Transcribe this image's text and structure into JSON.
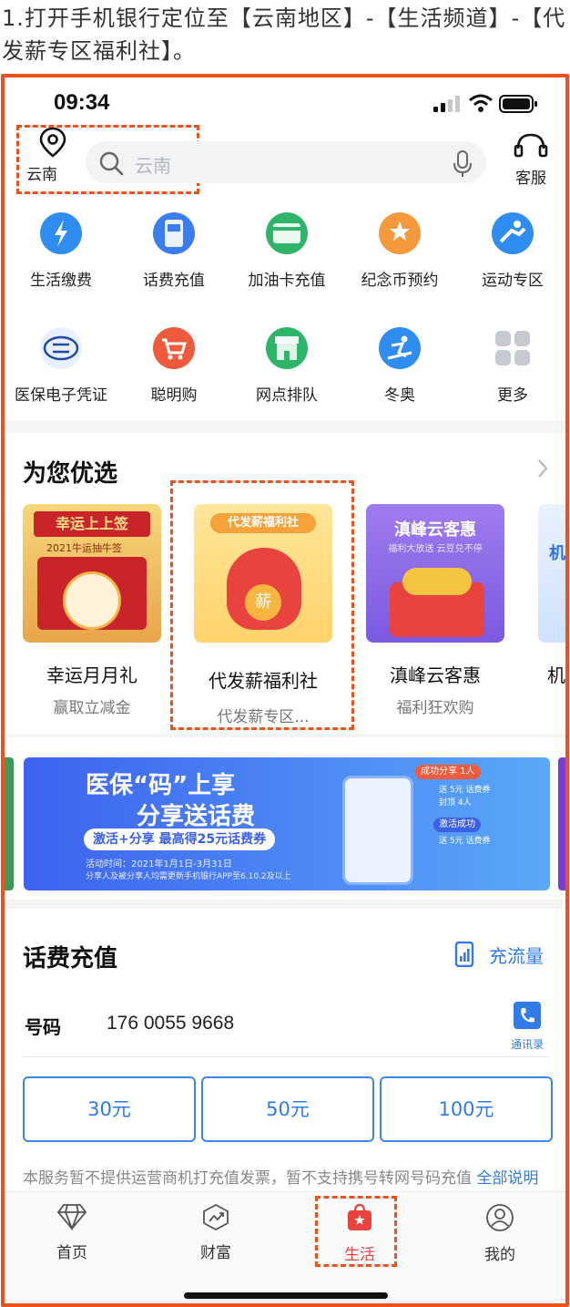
{
  "caption": "1.打开手机银行定位至【云南地区】-【生活频道】-【代发薪专区福利社】。",
  "status": {
    "time": "09:34"
  },
  "header": {
    "location_label": "云南",
    "search_placeholder": "云南",
    "service_label": "客服"
  },
  "services": [
    {
      "label": "生活缴费",
      "icon": "lightning-icon",
      "color": "#2f8cf0"
    },
    {
      "label": "话费充值",
      "icon": "phone-bill-icon",
      "color": "#3b7df0"
    },
    {
      "label": "加油卡充值",
      "icon": "fuel-card-icon",
      "color": "#2fb56a"
    },
    {
      "label": "纪念币预约",
      "icon": "coin-star-icon",
      "color": "#f59a3c"
    },
    {
      "label": "运动专区",
      "icon": "sport-icon",
      "color": "#2f8cf0"
    },
    {
      "label": "医保电子凭证",
      "icon": "chs-icon",
      "color": "#1f4aa8"
    },
    {
      "label": "聪明购",
      "icon": "cart-icon",
      "color": "#f05a3c"
    },
    {
      "label": "网点排队",
      "icon": "store-icon",
      "color": "#2fb56a"
    },
    {
      "label": "冬奥",
      "icon": "ski-icon",
      "color": "#2f8cf0"
    },
    {
      "label": "更多",
      "icon": "more-grid-icon",
      "color": "#c6c9cf"
    }
  ],
  "picks": {
    "title": "为您优选",
    "cards": [
      {
        "title": "幸运月月礼",
        "subtitle": "赢取立减金",
        "img_text": "幸运上上签",
        "img_sub": "2021牛运抽牛签"
      },
      {
        "title": "代发薪福利社",
        "subtitle": "代发薪专区...",
        "img_text": "代发薪福利社",
        "badge": "薪"
      },
      {
        "title": "滇峰云客惠",
        "subtitle": "福利狂欢购",
        "img_text": "滇峰云客惠",
        "img_sub": "福利大放送 云豆兑不停"
      },
      {
        "title": "机",
        "subtitle": "",
        "img_text": "机"
      }
    ]
  },
  "banner": {
    "line1": "医保“码”上享",
    "line2": "分享送话费",
    "line3": "激活+分享 最高得25元话费券",
    "line4": "活动时间：2021年1月1日-3月31日",
    "line5": "分享人及被分享人均需更新手机银行APP至6.10.2及以上",
    "tag1": "成功分享 1人",
    "tag1_sub": "送 5元 话费券",
    "tag1_sub2": "封顶 4人",
    "tag2": "激活成功",
    "tag2_sub": "送 5元 话费券"
  },
  "recharge": {
    "title": "话费充值",
    "flow_label": "充流量",
    "number_label": "号码",
    "number": "176 0055 9668",
    "contacts_label": "通讯录",
    "amounts": [
      "30元",
      "50元",
      "100元"
    ],
    "note": "本服务暂不提供运营商机打充值发票，暂不支持携号转网号码充值",
    "note_more": "全部说明"
  },
  "tabs": [
    {
      "label": "首页",
      "icon": "diamond-icon"
    },
    {
      "label": "财富",
      "icon": "wealth-chart-icon"
    },
    {
      "label": "生活",
      "icon": "life-bag-icon"
    },
    {
      "label": "我的",
      "icon": "user-icon"
    }
  ],
  "colors": {
    "accent": "#2f7ce8",
    "highlight": "#f0511b",
    "active_tab": "#e8433f"
  }
}
